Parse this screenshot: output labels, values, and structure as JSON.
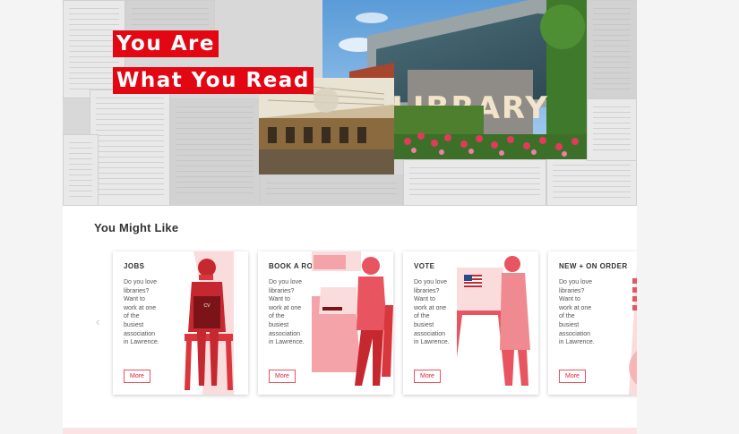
{
  "hero": {
    "tagline_line1": "You Are",
    "tagline_line2": "What You Read",
    "sign_text": "LIBRARY"
  },
  "section": {
    "title": "You Might Like"
  },
  "cards": [
    {
      "title": "JOBS",
      "desc": "Do you love libraries? Want to work at one of the busiest association in Lawrence.",
      "more": "More",
      "art_label": "CV"
    },
    {
      "title": "BOOK A ROOM",
      "desc": "Do you love libraries? Want to work at one of the busiest association in Lawrence.",
      "more": "More"
    },
    {
      "title": "VOTE",
      "desc": "Do you love libraries? Want to work at one of the busiest association in Lawrence.",
      "more": "More"
    },
    {
      "title": "NEW + ON ORDER",
      "desc": "Do you love libraries? Want to work at one of the busiest association in Lawrence.",
      "more": "More"
    }
  ],
  "carousel": {
    "prev_icon": "‹"
  },
  "colors": {
    "accent": "#e30613",
    "art": "#e8545f",
    "art_light": "#f4a3a8"
  }
}
